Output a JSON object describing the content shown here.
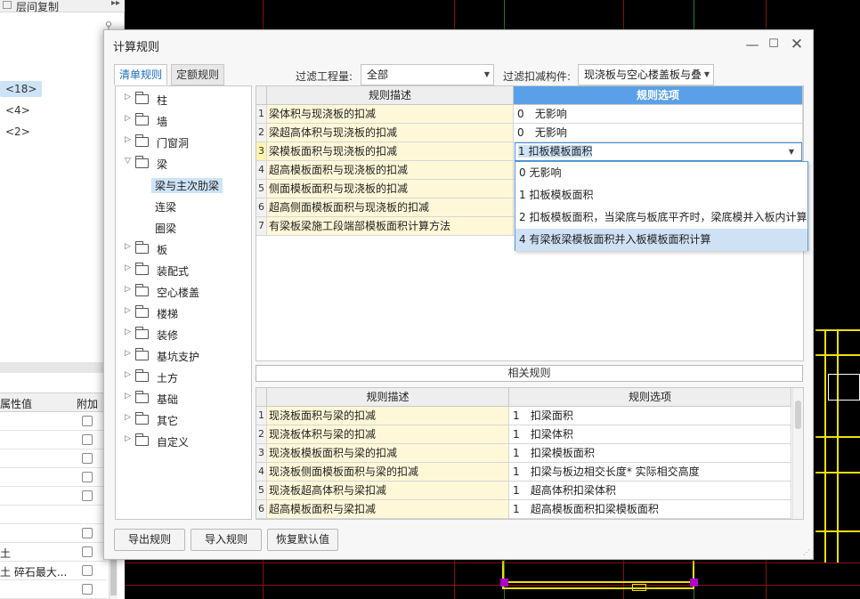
{
  "background": {
    "panel_title": "层间复制",
    "floors": [
      "<18>",
      "<4>",
      "<2>"
    ],
    "props_headers": [
      "属性值",
      "附加"
    ],
    "props_rows": [
      "",
      "",
      "",
      "",
      "",
      "",
      "",
      "土",
      "土 碎石最大...",
      ""
    ]
  },
  "dialog": {
    "title": "计算规则",
    "tabs": [
      "清单规则",
      "定额规则"
    ],
    "filter_quantity_label": "过滤工程量:",
    "filter_quantity_value": "全部",
    "filter_component_label": "过滤扣减构件:",
    "filter_component_value": "现浇板与空心楼盖板与叠",
    "tree": [
      {
        "label": "柱",
        "expanded": false
      },
      {
        "label": "墙",
        "expanded": false
      },
      {
        "label": "门窗洞",
        "expanded": false
      },
      {
        "label": "梁",
        "expanded": true
      },
      {
        "label": "梁与主次肋梁",
        "child": true,
        "selected": true
      },
      {
        "label": "连梁",
        "child": true
      },
      {
        "label": "圈梁",
        "child": true
      },
      {
        "label": "板",
        "expanded": false
      },
      {
        "label": "装配式",
        "expanded": false
      },
      {
        "label": "空心楼盖",
        "expanded": false
      },
      {
        "label": "楼梯",
        "expanded": false
      },
      {
        "label": "装修",
        "expanded": false
      },
      {
        "label": "基坑支护",
        "expanded": false
      },
      {
        "label": "土方",
        "expanded": false
      },
      {
        "label": "基础",
        "expanded": false
      },
      {
        "label": "其它",
        "expanded": false
      },
      {
        "label": "自定义",
        "expanded": false
      }
    ],
    "rules_table": {
      "headers": [
        "规则描述",
        "规则选项"
      ],
      "rows": [
        {
          "num": "1",
          "desc": "梁体积与现浇板的扣减",
          "code": "0",
          "option": "无影响"
        },
        {
          "num": "2",
          "desc": "梁超高体积与现浇板的扣减",
          "code": "0",
          "option": "无影响"
        },
        {
          "num": "3",
          "desc": "梁模板面积与现浇板的扣减",
          "code": "",
          "option": ""
        },
        {
          "num": "4",
          "desc": "超高模板面积与现浇板的扣减",
          "code": "",
          "option": ""
        },
        {
          "num": "5",
          "desc": "侧面模板面积与现浇板的扣减",
          "code": "",
          "option": ""
        },
        {
          "num": "6",
          "desc": "超高侧面模板面积与现浇板的扣减",
          "code": "",
          "option": ""
        },
        {
          "num": "7",
          "desc": "有梁板梁施工段端部模板面积计算方法",
          "code": "",
          "option": ""
        }
      ]
    },
    "dropdown": {
      "current": "1 扣板模板面积",
      "options": [
        "0  无影响",
        "1 扣板模板面积",
        "2 扣板模板面积，当梁底与板底平齐时，梁底模并入板内计算",
        "4 有梁板梁模板面积并入板模板面积计算"
      ],
      "highlighted_index": 3
    },
    "related_title": "相关规则",
    "related_table": {
      "headers": [
        "规则描述",
        "规则选项"
      ],
      "rows": [
        {
          "num": "1",
          "desc": "现浇板面积与梁的扣减",
          "code": "1",
          "option": "扣梁面积"
        },
        {
          "num": "2",
          "desc": "现浇板体积与梁的扣减",
          "code": "1",
          "option": "扣梁体积"
        },
        {
          "num": "3",
          "desc": "现浇板模板面积与梁的扣减",
          "code": "1",
          "option": "扣梁模板面积"
        },
        {
          "num": "4",
          "desc": "现浇板侧面模板面积与梁的扣减",
          "code": "1",
          "option": "扣梁与板边相交长度* 实际相交高度"
        },
        {
          "num": "5",
          "desc": "现浇板超高体积与梁扣减",
          "code": "1",
          "option": "超高体积扣梁体积"
        },
        {
          "num": "6",
          "desc": "超高模板面积与梁扣减",
          "code": "1",
          "option": "超高模板面积扣梁模板面积"
        }
      ]
    },
    "buttons": {
      "export": "导出规则",
      "import": "导入规则",
      "restore": "恢复默认值"
    }
  },
  "colors": {
    "accent_header": "#5aa0e8",
    "desc_cell_bg": "#fff8d8",
    "cad_yellow": "#f0e000",
    "cad_red": "#a01010",
    "cad_green": "#2a7a2a",
    "cad_magenta": "#b000d0"
  }
}
